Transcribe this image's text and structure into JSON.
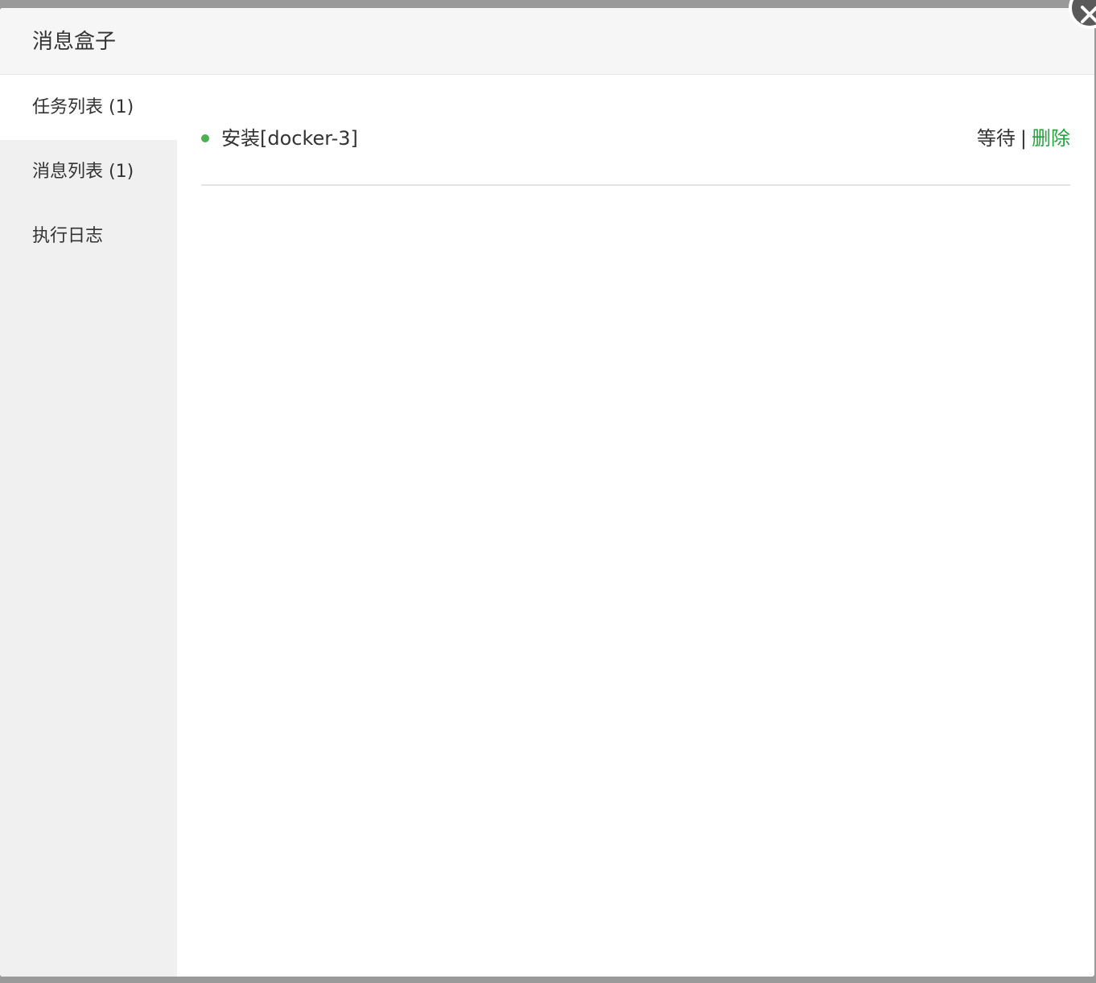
{
  "dialog": {
    "title": "消息盒子"
  },
  "sidebar": {
    "items": [
      {
        "label": "任务列表 (1)",
        "active": true
      },
      {
        "label": "消息列表 (1)",
        "active": false
      },
      {
        "label": "执行日志",
        "active": false
      }
    ]
  },
  "tasks": [
    {
      "name": "安装[docker-3]",
      "status": "等待",
      "separator": "|",
      "delete_label": "删除"
    }
  ],
  "colors": {
    "accent": "#20a53a",
    "dot": "#4caf50",
    "sidebar_bg": "#f0f0f0",
    "header_bg": "#f6f6f6"
  },
  "icons": {
    "close": "close-icon"
  }
}
